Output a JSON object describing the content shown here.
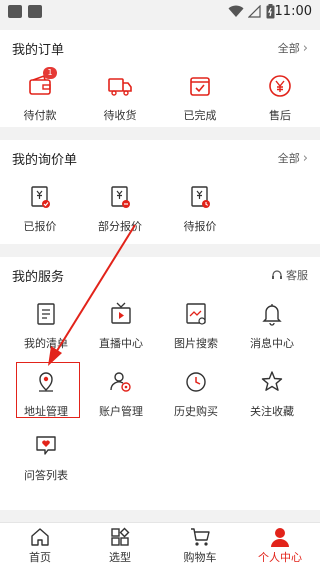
{
  "status_bar": {
    "time": "11:00"
  },
  "orders": {
    "title": "我的订单",
    "link": "全部",
    "items": [
      {
        "label": "待付款",
        "icon": "wallet-icon",
        "badge": "1"
      },
      {
        "label": "待收货",
        "icon": "truck-icon"
      },
      {
        "label": "已完成",
        "icon": "box-check-icon"
      },
      {
        "label": "售后",
        "icon": "yen-service-icon"
      }
    ]
  },
  "inquiry": {
    "title": "我的询价单",
    "link": "全部",
    "items": [
      {
        "label": "已报价",
        "icon": "quote-done-icon"
      },
      {
        "label": "部分报价",
        "icon": "quote-partial-icon"
      },
      {
        "label": "待报价",
        "icon": "quote-pending-icon"
      }
    ]
  },
  "services": {
    "title": "我的服务",
    "link": "客服",
    "items": [
      {
        "label": "我的清单",
        "icon": "list-icon"
      },
      {
        "label": "直播中心",
        "icon": "tv-icon"
      },
      {
        "label": "图片搜索",
        "icon": "image-search-icon"
      },
      {
        "label": "消息中心",
        "icon": "bell-icon"
      },
      {
        "label": "地址管理",
        "icon": "location-pin-icon"
      },
      {
        "label": "账户管理",
        "icon": "account-settings-icon"
      },
      {
        "label": "历史购买",
        "icon": "clock-icon"
      },
      {
        "label": "关注收藏",
        "icon": "star-icon"
      },
      {
        "label": "问答列表",
        "icon": "chat-heart-icon"
      }
    ]
  },
  "tabs": [
    {
      "label": "首页",
      "icon": "home-icon"
    },
    {
      "label": "选型",
      "icon": "grid-icon"
    },
    {
      "label": "购物车",
      "icon": "cart-icon"
    },
    {
      "label": "个人中心",
      "icon": "person-icon",
      "active": true
    }
  ],
  "colors": {
    "accent": "#e2231a",
    "text": "#222222",
    "background": "#f2f2f2"
  }
}
